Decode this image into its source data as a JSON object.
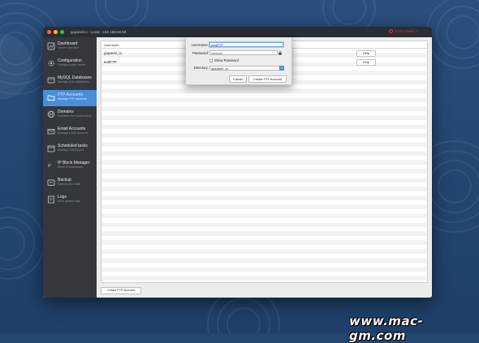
{
  "window": {
    "title": "gopanel.io - Local - 192.168.68.59",
    "disconnect_label": "DISCONNECT",
    "colors": {
      "close": "#ff5f57",
      "minimize": "#febc2e",
      "zoom": "#28c840",
      "accent": "#4a8ddb",
      "danger": "#d24a44"
    }
  },
  "sidebar": {
    "items": [
      {
        "title": "Dashboard",
        "subtitle": "Server overview",
        "icon": "dashboard-icon"
      },
      {
        "title": "Configuration",
        "subtitle": "Configure your server",
        "icon": "gear-icon"
      },
      {
        "title": "MySQL Databases",
        "subtitle": "Manage your databases",
        "icon": "database-icon"
      },
      {
        "title": "FTP Accounts",
        "subtitle": "Manage FTP accounts",
        "icon": "folder-icon",
        "active": true
      },
      {
        "title": "Domains",
        "subtitle": "Domains and subdomains",
        "icon": "globe-icon"
      },
      {
        "title": "Email Accounts",
        "subtitle": "Manage email accounts",
        "icon": "envelope-icon"
      },
      {
        "title": "Scheduled tasks",
        "subtitle": "Manage CRON jobs",
        "icon": "calendar-icon"
      },
      {
        "title": "IP Block Manager",
        "subtitle": "Block IP Addresses",
        "icon": "ip-block-icon"
      },
      {
        "title": "Backup",
        "subtitle": "Backup your data",
        "icon": "backup-icon"
      },
      {
        "title": "Logs",
        "subtitle": "View system logs",
        "icon": "logs-icon"
      }
    ]
  },
  "table": {
    "header": "Username",
    "rows": [
      {
        "username": "gopanel_io",
        "action": "Help"
      },
      {
        "username": "testFTP",
        "action": "Help"
      }
    ]
  },
  "create_button_label": "Create FTP Account",
  "dialog": {
    "username_label": "Username:",
    "username_value": "newFTP",
    "password_label": "Password:",
    "password_value": "••••••••••",
    "show_password_label": "Show Password",
    "directory_label": "Directory:",
    "directory_value": "/gopanel_io",
    "cancel_label": "Cancel",
    "create_label": "Create FTP Account"
  },
  "watermark": "www.mac-gm.com"
}
